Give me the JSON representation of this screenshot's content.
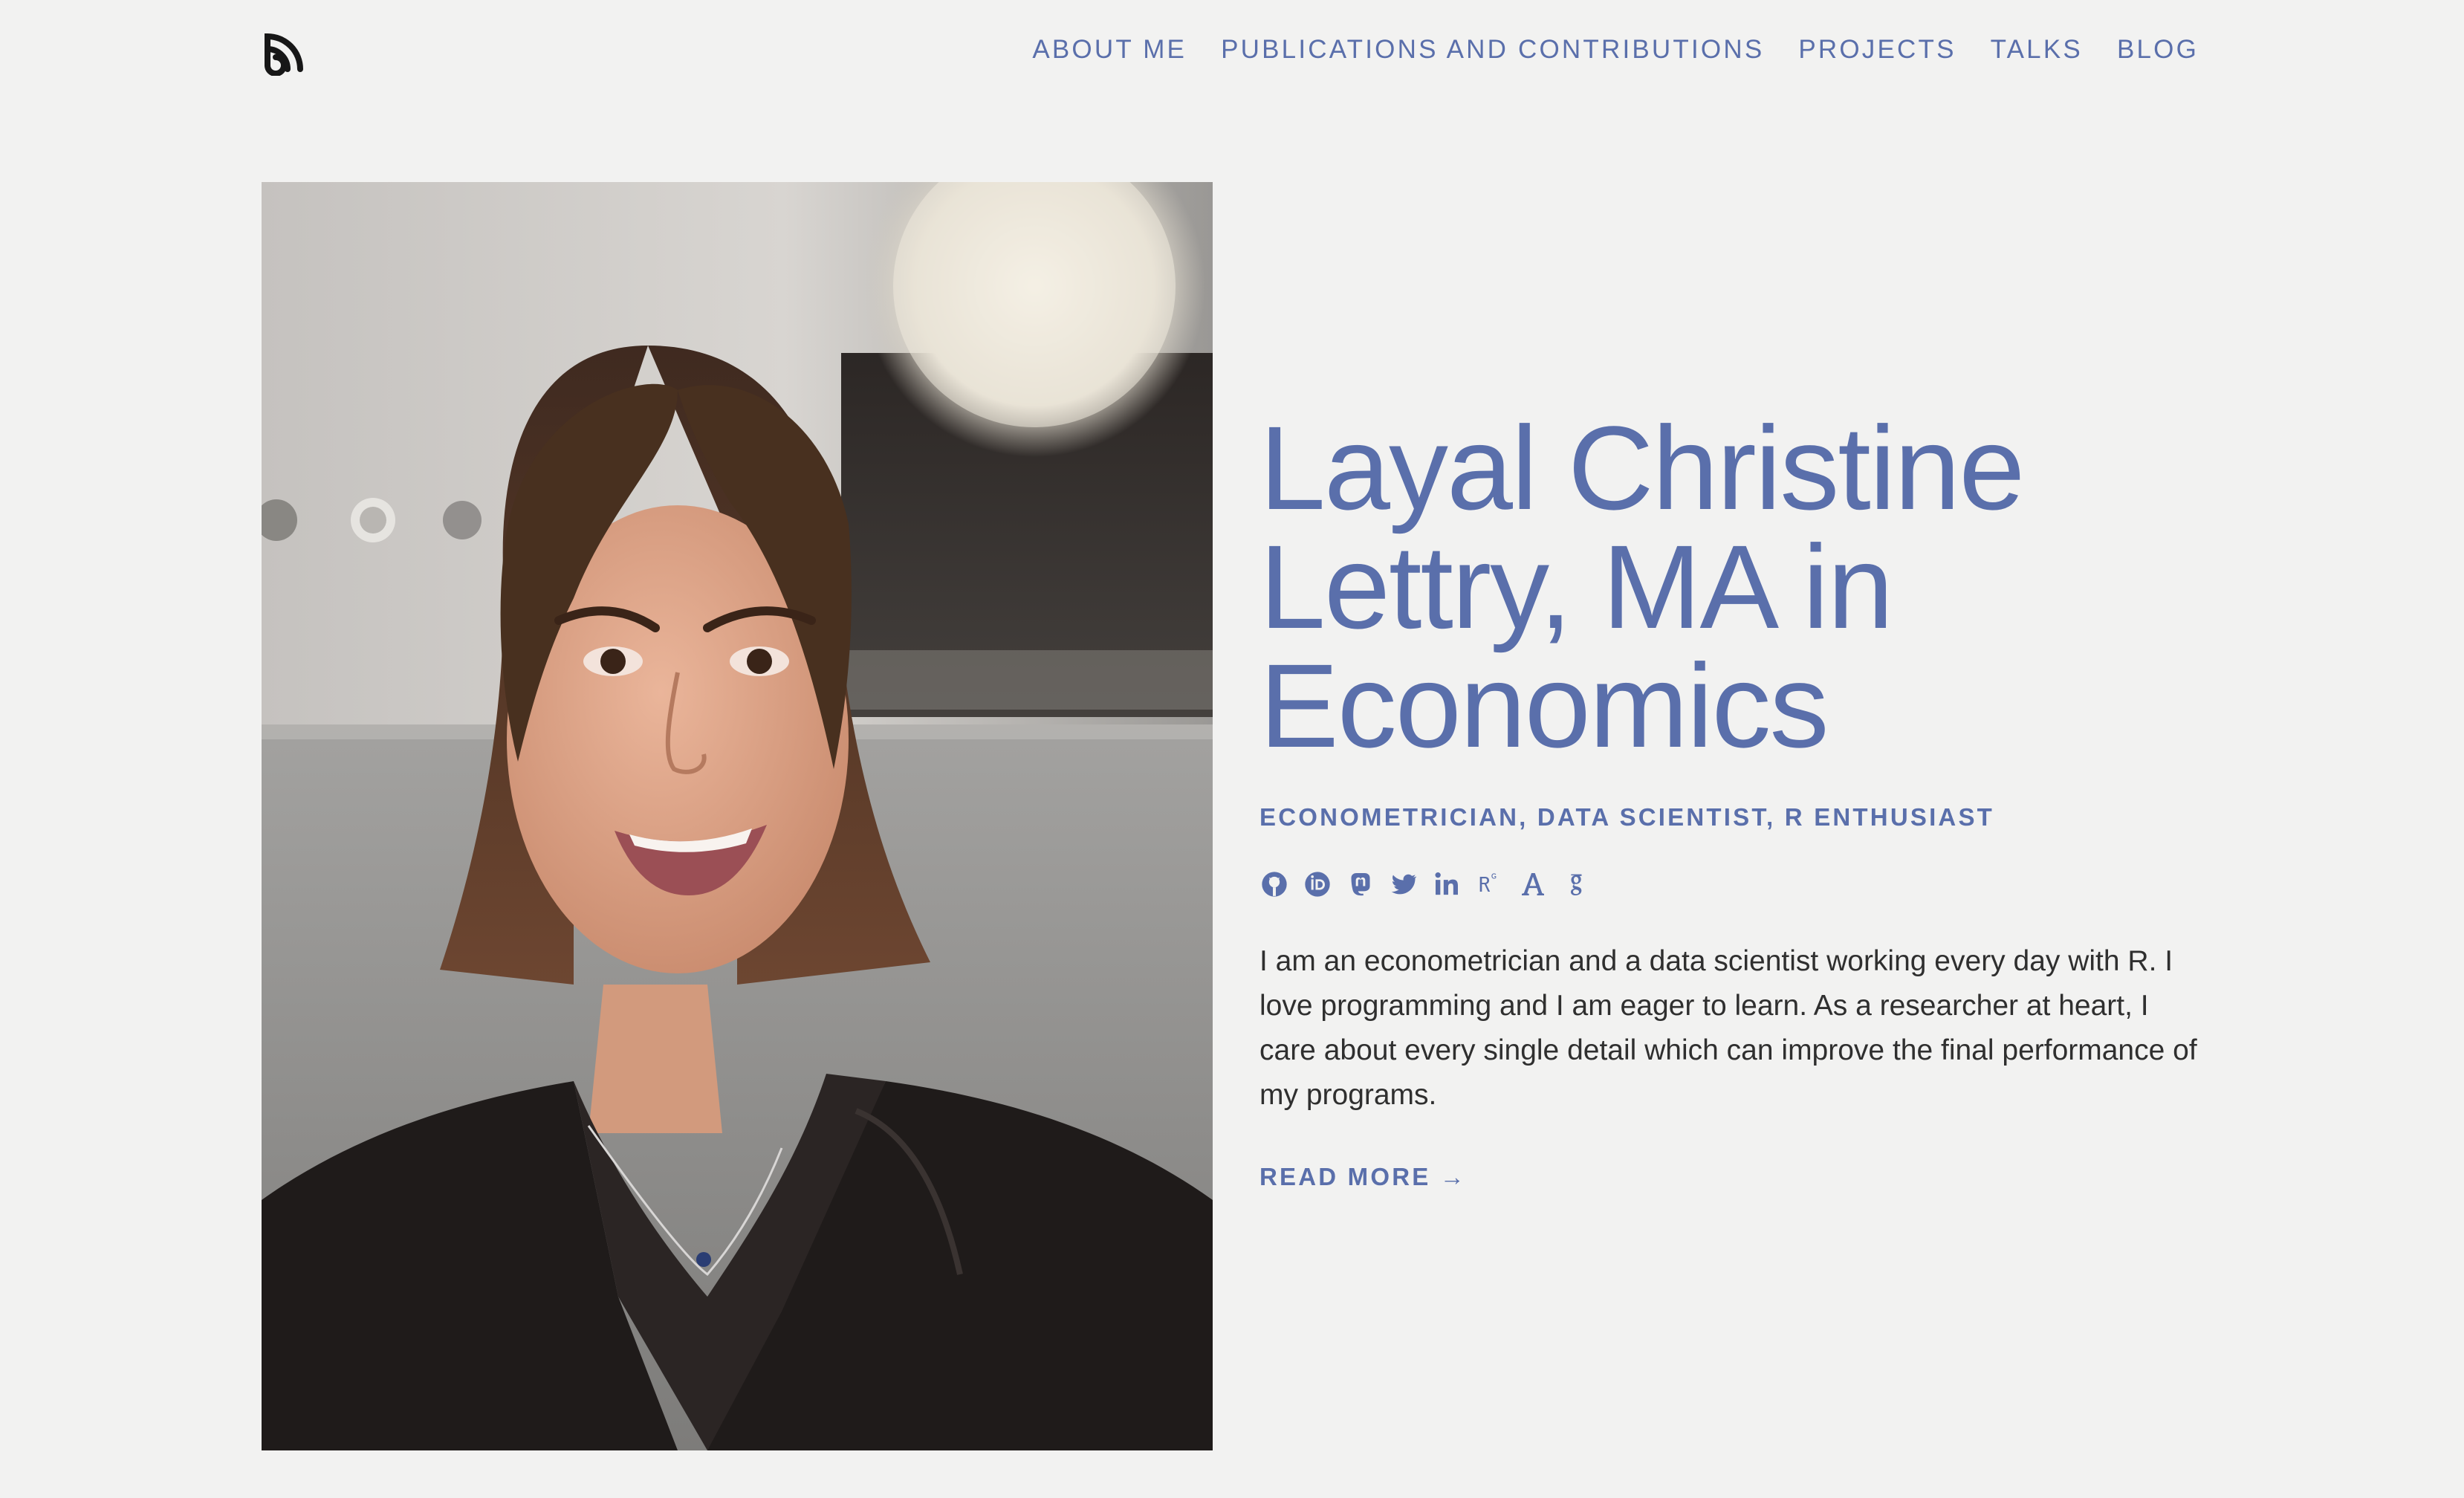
{
  "nav": {
    "items": [
      {
        "label": "ABOUT ME"
      },
      {
        "label": "PUBLICATIONS AND CONTRIBUTIONS"
      },
      {
        "label": "PROJECTS"
      },
      {
        "label": "TALKS"
      },
      {
        "label": "BLOG"
      }
    ]
  },
  "logo": {
    "icon": "site-logo-icon"
  },
  "hero": {
    "title": "Layal Christine Lettry, MA in Economics",
    "subtitle": "ECONOMETRICIAN, DATA SCIENTIST, R ENTHUSIAST",
    "bio": "I am an econometrician and a data scientist working every day with R. I love programming and I am eager to learn. As a researcher at heart, I care about every single detail which can improve the final performance of my programs.",
    "read_more": "READ MORE →"
  },
  "social": [
    {
      "icon": "github-icon"
    },
    {
      "icon": "orcid-icon"
    },
    {
      "icon": "mastodon-icon"
    },
    {
      "icon": "twitter-icon"
    },
    {
      "icon": "linkedin-icon"
    },
    {
      "icon": "researchgate-icon"
    },
    {
      "icon": "academia-icon"
    },
    {
      "icon": "google-scholar-icon"
    }
  ],
  "colors": {
    "accent": "#5a6fab",
    "background": "#f2f2f1",
    "body_text": "#2f2f2f"
  }
}
